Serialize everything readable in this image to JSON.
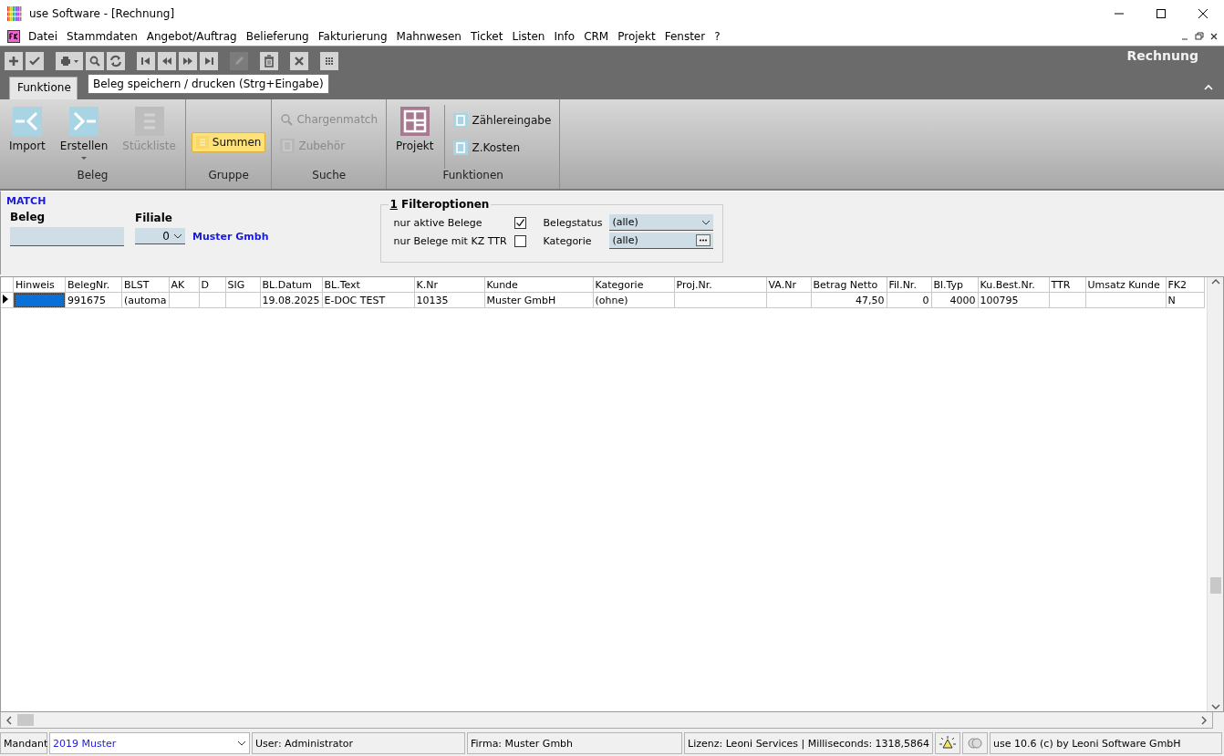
{
  "window": {
    "title": "use Software - [Rechnung]"
  },
  "menu": [
    "Datei",
    "Stammdaten",
    "Angebot/Auftrag",
    "Belieferung",
    "Fakturierung",
    "Mahnwesen",
    "Ticket",
    "Listen",
    "Info",
    "CRM",
    "Projekt",
    "Fenster",
    "?"
  ],
  "toolbar": {
    "buttons": [
      {
        "kind": "add",
        "disabled": false
      },
      {
        "kind": "check",
        "disabled": false
      },
      {
        "kind": "print",
        "disabled": false
      },
      {
        "kind": "search",
        "disabled": false
      },
      {
        "kind": "refresh",
        "disabled": false
      },
      {
        "kind": "first",
        "disabled": false
      },
      {
        "kind": "prev",
        "disabled": false
      },
      {
        "kind": "next",
        "disabled": false
      },
      {
        "kind": "last",
        "disabled": false
      },
      {
        "kind": "edit",
        "disabled": true
      },
      {
        "kind": "delete",
        "disabled": false
      },
      {
        "kind": "cancel",
        "disabled": false
      },
      {
        "kind": "grid",
        "disabled": false
      }
    ],
    "title": "Rechnung",
    "tooltip": "Beleg speichern / drucken (Strg+Eingabe)"
  },
  "tabs": [
    {
      "label": "Funktione",
      "selected": true
    }
  ],
  "ribbon": {
    "groups": [
      {
        "label": "Beleg",
        "items": [
          {
            "kind": "import",
            "label": "Import",
            "disabled": false
          },
          {
            "kind": "export",
            "label": "Erstellen",
            "disabled": false,
            "dropdown": true
          },
          {
            "kind": "list",
            "label": "Stückliste",
            "disabled": true
          }
        ]
      },
      {
        "label": "Gruppe",
        "items": [
          {
            "kind": "toggle",
            "label": "Summen",
            "disabled": false,
            "on": true
          }
        ]
      },
      {
        "label": "Suche",
        "items": [
          {
            "kind": "search",
            "label": "Chargenmatch",
            "disabled": true
          },
          {
            "kind": "square",
            "label": "Zubehör",
            "disabled": true
          }
        ]
      },
      {
        "label": "Funktionen",
        "items": [
          {
            "kind": "project",
            "label": "Projekt",
            "disabled": false
          },
          {
            "kind": "square",
            "label": "Zählereingabe",
            "disabled": false
          },
          {
            "kind": "square",
            "label": "Z.Kosten",
            "disabled": false
          }
        ]
      }
    ]
  },
  "filter": {
    "heading": "MATCH",
    "beleg": {
      "label": "Beleg"
    },
    "filiale": {
      "label": "Filiale",
      "value": "0"
    },
    "company": "Muster Gmbh",
    "options": {
      "number": "1",
      "title": "Filteroptionen",
      "checks": [
        {
          "label": "nur aktive Belege",
          "checked": true
        },
        {
          "label": "nur Belege mit KZ TTR",
          "checked": false
        }
      ],
      "selects": [
        {
          "label": "Belegstatus",
          "value": "(alle)",
          "kind": "dropdown"
        },
        {
          "label": "Kategorie",
          "value": "(alle)",
          "kind": "picker"
        }
      ]
    }
  },
  "table": {
    "columns": [
      {
        "label": "Hinweis",
        "kind": "text"
      },
      {
        "label": "BelegNr.",
        "kind": "text"
      },
      {
        "label": "BLST",
        "kind": "text"
      },
      {
        "label": "AK",
        "kind": "text"
      },
      {
        "label": "D",
        "kind": "text"
      },
      {
        "label": "SIG",
        "kind": "text"
      },
      {
        "label": "BL.Datum",
        "kind": "text"
      },
      {
        "label": "BL.Text",
        "kind": "text"
      },
      {
        "label": "K.Nr",
        "kind": "text"
      },
      {
        "label": "Kunde",
        "kind": "text"
      },
      {
        "label": "Kategorie",
        "kind": "text"
      },
      {
        "label": "Proj.Nr.",
        "kind": "text"
      },
      {
        "label": "VA.Nr",
        "kind": "text"
      },
      {
        "label": "Betrag Netto",
        "kind": "number"
      },
      {
        "label": "Fil.Nr.",
        "kind": "number"
      },
      {
        "label": "Bl.Typ",
        "kind": "number"
      },
      {
        "label": "Ku.Best.Nr.",
        "kind": "text"
      },
      {
        "label": "TTR",
        "kind": "text"
      },
      {
        "label": "Umsatz Kunde",
        "kind": "text"
      },
      {
        "label": "FK2",
        "kind": "text"
      }
    ],
    "rows": [
      {
        "selected": true,
        "cells": [
          "",
          "991675",
          "(automa",
          "",
          "",
          "",
          "19.08.2025",
          "E-DOC TEST",
          "10135",
          "Muster GmbH",
          "(ohne)",
          "",
          "",
          "47,50",
          "0",
          "4000",
          "100795",
          "",
          "",
          "N"
        ]
      }
    ]
  },
  "status_bar": {
    "mandant_label": "Mandant",
    "mandant": "2019 Muster",
    "user": "User: Administrator",
    "firma": "Firma: Muster Gmbh",
    "lizenz": "Lizenz: Leoni Services | Milliseconds: 1318,5864",
    "version": "use 10.6 (c) by Leoni Software GmbH"
  }
}
